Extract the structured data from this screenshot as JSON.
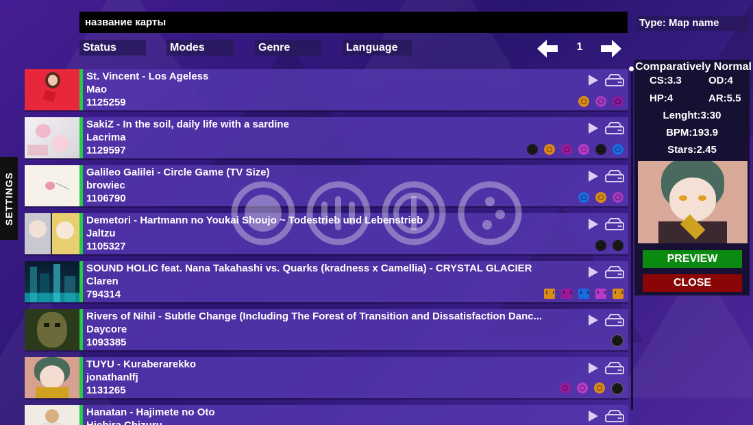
{
  "search": {
    "value": "название карты",
    "type_label": "Type: Map name"
  },
  "filters": {
    "status": "Status",
    "modes": "Modes",
    "genre": "Genre",
    "language": "Language"
  },
  "pagination": {
    "page": "1"
  },
  "settings_label": "SETTINGS",
  "beatmaps": [
    {
      "title": "St. Vincent - Los Ageless",
      "mapper": "Mao",
      "id": "1125259"
    },
    {
      "title": "SakiZ - In the soil, daily life with a sardine",
      "mapper": "Lacrima",
      "id": "1129597"
    },
    {
      "title": "Galileo Galilei - Circle Game (TV Size)",
      "mapper": "browiec",
      "id": "1106790"
    },
    {
      "title": "Demetori - Hartmann no Youkai Shoujo ~ Todestrieb und Lebenstrieb",
      "mapper": "Jaltzu",
      "id": "1105327"
    },
    {
      "title": "SOUND HOLIC feat. Nana Takahashi vs. Quarks (kradness x Camellia) - CRYSTAL GLACIER",
      "mapper": "Claren",
      "id": "794314"
    },
    {
      "title": "Rivers of Nihil - Subtle Change (Including The Forest of Transition and Dissatisfaction Danc...",
      "mapper": "Daycore",
      "id": "1093385"
    },
    {
      "title": "TUYU - Kuraberarekko",
      "mapper": "jonathanlfj",
      "id": "1131265"
    },
    {
      "title": "Hanatan - Hajimete no Oto",
      "mapper": "Hiebira Chizuru",
      "id": ""
    }
  ],
  "details": {
    "difficulty_name": "Comparatively Normal",
    "cs": "CS:3.3",
    "od": "OD:4",
    "hp": "HP:4",
    "ar": "AR:5.5",
    "length": "Lenght:3:30",
    "bpm": "BPM:193.9",
    "stars": "Stars:2.45",
    "preview_label": "PREVIEW",
    "close_label": "CLOSE"
  },
  "colors": {
    "accent_green": "#22cc44",
    "preview_button": "#0b8a12",
    "close_button": "#8a0606",
    "row_background": "#5537af"
  }
}
